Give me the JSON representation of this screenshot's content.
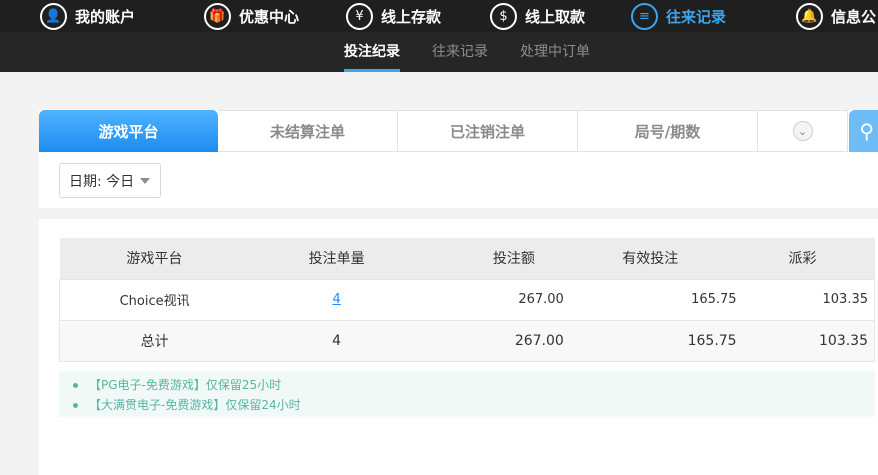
{
  "topnav": {
    "items": [
      {
        "label": "我的账户",
        "icon": "user-icon",
        "glyph": "👤"
      },
      {
        "label": "优惠中心",
        "icon": "gift-icon",
        "glyph": "🎁"
      },
      {
        "label": "线上存款",
        "icon": "deposit-icon",
        "glyph": "¥"
      },
      {
        "label": "线上取款",
        "icon": "withdraw-icon",
        "glyph": "$"
      },
      {
        "label": "往来记录",
        "icon": "records-icon",
        "glyph": "≡"
      },
      {
        "label": "信息公",
        "icon": "bell-icon",
        "glyph": "🔔"
      }
    ],
    "active_color": "#3aa5f0"
  },
  "subnav": {
    "items": [
      "投注纪录",
      "往来记录",
      "处理中订单"
    ]
  },
  "filter": {
    "tabs": [
      "游戏平台",
      "未结算注单",
      "已注销注单",
      "局号/期数"
    ],
    "date_label": "日期: 今日"
  },
  "table": {
    "headers": [
      "游戏平台",
      "投注单量",
      "投注额",
      "有效投注",
      "派彩"
    ],
    "rows": [
      {
        "platform": "Choice视讯",
        "count": "4",
        "bet": "267.00",
        "valid": "165.75",
        "payout": "103.35"
      }
    ],
    "total": {
      "label": "总计",
      "count": "4",
      "bet": "267.00",
      "valid": "165.75",
      "payout": "103.35"
    }
  },
  "notices": [
    "【PG电子-免费游戏】仅保留25小时",
    "【大满贯电子-免费游戏】仅保留24小时"
  ]
}
